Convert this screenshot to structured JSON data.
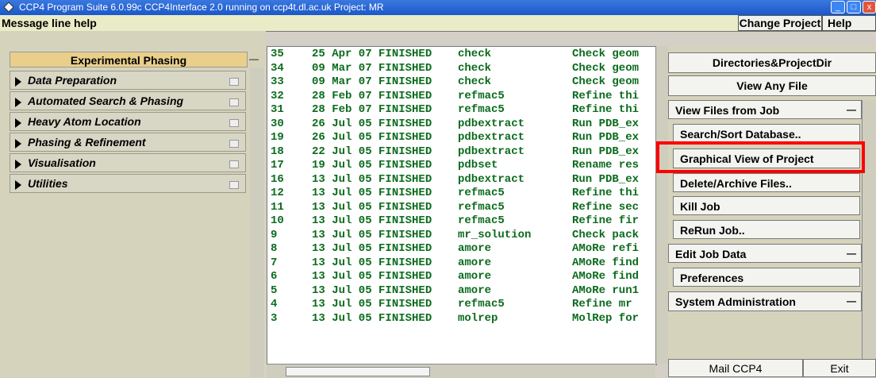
{
  "window": {
    "title": "CCP4 Program Suite 6.0.99c CCP4Interface 2.0 running on ccp4t.dl.ac.uk   Project: MR"
  },
  "header": {
    "message": "Message line help",
    "change_project": "Change Project",
    "help": "Help"
  },
  "left_panel": {
    "title": "Experimental Phasing",
    "folders": [
      {
        "label": "Data Preparation"
      },
      {
        "label": "Automated Search & Phasing"
      },
      {
        "label": "Heavy Atom Location"
      },
      {
        "label": "Phasing & Refinement"
      },
      {
        "label": "Visualisation"
      },
      {
        "label": "Utilities"
      }
    ]
  },
  "jobs": [
    {
      "id": "35",
      "date": "25 Apr 07 FINISHED",
      "program": "check",
      "desc": "Check geom"
    },
    {
      "id": "34",
      "date": "09 Mar 07 FINISHED",
      "program": "check",
      "desc": "Check geom"
    },
    {
      "id": "33",
      "date": "09 Mar 07 FINISHED",
      "program": "check",
      "desc": "Check geom"
    },
    {
      "id": "32",
      "date": "28 Feb 07 FINISHED",
      "program": "refmac5",
      "desc": "Refine thi"
    },
    {
      "id": "31",
      "date": "28 Feb 07 FINISHED",
      "program": "refmac5",
      "desc": "Refine thi"
    },
    {
      "id": "30",
      "date": "26 Jul 05 FINISHED",
      "program": "pdbextract",
      "desc": "Run PDB_ex"
    },
    {
      "id": "19",
      "date": "26 Jul 05 FINISHED",
      "program": "pdbextract",
      "desc": "Run PDB_ex"
    },
    {
      "id": "18",
      "date": "22 Jul 05 FINISHED",
      "program": "pdbextract",
      "desc": "Run PDB_ex"
    },
    {
      "id": "17",
      "date": "19 Jul 05 FINISHED",
      "program": "pdbset",
      "desc": "Rename res"
    },
    {
      "id": "16",
      "date": "13 Jul 05 FINISHED",
      "program": "pdbextract",
      "desc": "Run PDB_ex"
    },
    {
      "id": "12",
      "date": "13 Jul 05 FINISHED",
      "program": "refmac5",
      "desc": "Refine thi"
    },
    {
      "id": "11",
      "date": "13 Jul 05 FINISHED",
      "program": "refmac5",
      "desc": "Refine sec"
    },
    {
      "id": "10",
      "date": "13 Jul 05 FINISHED",
      "program": "refmac5",
      "desc": "Refine fir"
    },
    {
      "id": "9",
      "date": "13 Jul 05 FINISHED",
      "program": "mr_solution",
      "desc": "Check pack"
    },
    {
      "id": "8",
      "date": "13 Jul 05 FINISHED",
      "program": "amore",
      "desc": "AMoRe refi"
    },
    {
      "id": "7",
      "date": "13 Jul 05 FINISHED",
      "program": "amore",
      "desc": "AMoRe find"
    },
    {
      "id": "6",
      "date": "13 Jul 05 FINISHED",
      "program": "amore",
      "desc": "AMoRe find"
    },
    {
      "id": "5",
      "date": "13 Jul 05 FINISHED",
      "program": "amore",
      "desc": "AMoRe run1"
    },
    {
      "id": "4",
      "date": "13 Jul 05 FINISHED",
      "program": "refmac5",
      "desc": "Refine mr"
    },
    {
      "id": "3",
      "date": "13 Jul 05 FINISHED",
      "program": "molrep",
      "desc": "MolRep for"
    }
  ],
  "right_panel": {
    "directories": "Directories&ProjectDir",
    "view_any_file": "View Any File",
    "view_files_from_job": "View Files from Job",
    "search_sort": "Search/Sort Database..",
    "graphical_view": "Graphical View of Project",
    "delete_archive": "Delete/Archive Files..",
    "kill_job": "Kill Job",
    "rerun_job": "ReRun Job..",
    "edit_job_data": "Edit Job Data",
    "preferences": "Preferences",
    "system_admin": "System Administration",
    "mail": "Mail CCP4",
    "exit": "Exit"
  },
  "colors": {
    "job_text": "#0b6b1d",
    "highlight": "#ff0000",
    "phasing_header": "#e9cf8a",
    "message_bar": "#e9ecc6"
  }
}
